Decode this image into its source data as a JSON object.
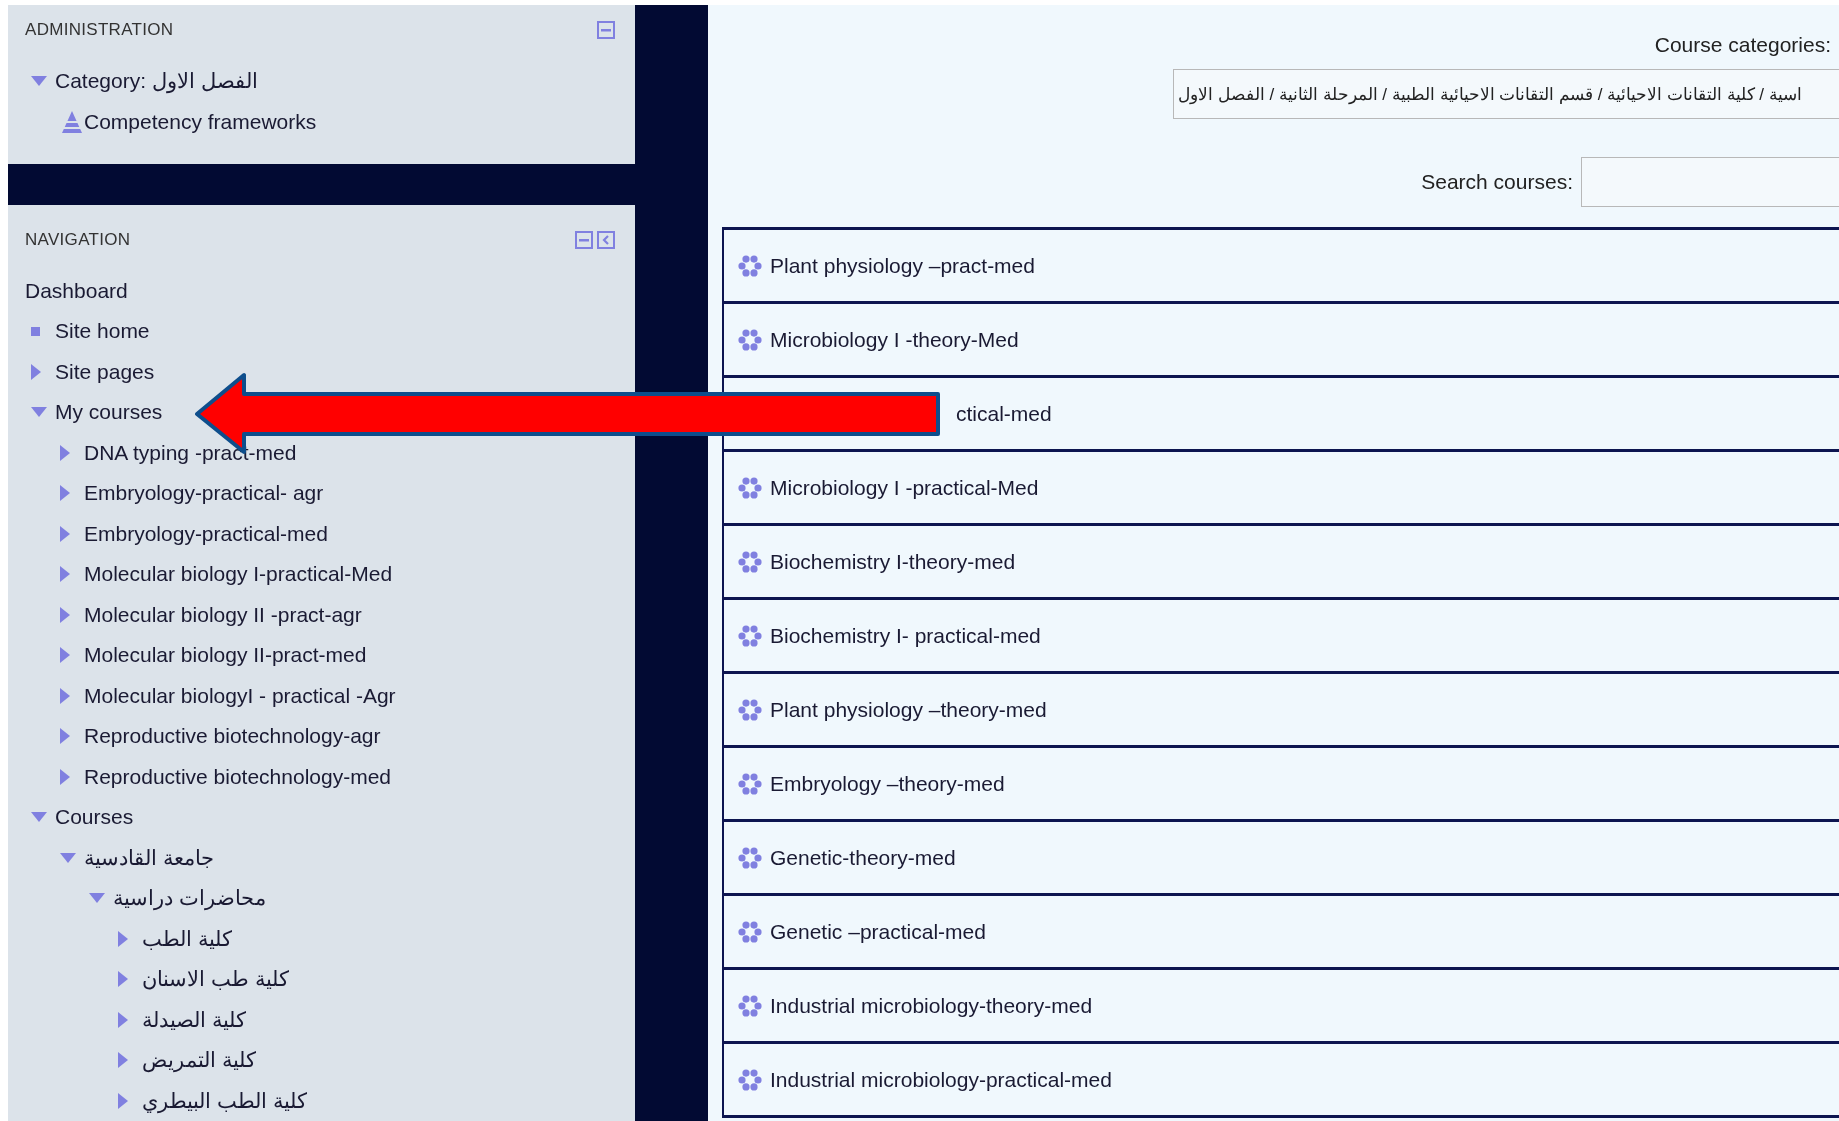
{
  "administration": {
    "title": "ADMINISTRATION",
    "items": [
      {
        "label": "Category: الفصل الاول",
        "kind": "node",
        "expanded": true,
        "children": [
          {
            "label": "Competency frameworks",
            "kind": "competency"
          }
        ]
      }
    ]
  },
  "navigation": {
    "title": "NAVIGATION",
    "items": [
      {
        "label": "Dashboard",
        "kind": "plain"
      },
      {
        "label": "Site home",
        "kind": "leaf"
      },
      {
        "label": "Site pages",
        "kind": "node",
        "expanded": false
      },
      {
        "label": "My courses",
        "kind": "node",
        "expanded": true,
        "children": [
          {
            "label": "DNA typing -pract-med",
            "kind": "node",
            "expanded": false
          },
          {
            "label": "Embryology-practical- agr",
            "kind": "node",
            "expanded": false
          },
          {
            "label": "Embryology-practical-med",
            "kind": "node",
            "expanded": false
          },
          {
            "label": "Molecular biology I-practical-Med",
            "kind": "node",
            "expanded": false
          },
          {
            "label": "Molecular biology II -pract-agr",
            "kind": "node",
            "expanded": false
          },
          {
            "label": "Molecular biology II-pract-med",
            "kind": "node",
            "expanded": false
          },
          {
            "label": "Molecular biologyI - practical -Agr",
            "kind": "node",
            "expanded": false
          },
          {
            "label": "Reproductive biotechnology-agr",
            "kind": "node",
            "expanded": false
          },
          {
            "label": "Reproductive biotechnology-med",
            "kind": "node",
            "expanded": false
          }
        ]
      },
      {
        "label": "Courses",
        "kind": "node",
        "expanded": true,
        "children": [
          {
            "label": "جامعة القادسية",
            "kind": "node",
            "expanded": true,
            "children": [
              {
                "label": "محاضرات دراسية",
                "kind": "node",
                "expanded": true,
                "children": [
                  {
                    "label": "كلية الطب",
                    "kind": "node",
                    "expanded": false
                  },
                  {
                    "label": "كلية طب الاسنان",
                    "kind": "node",
                    "expanded": false
                  },
                  {
                    "label": "كلية الصيدلة",
                    "kind": "node",
                    "expanded": false
                  },
                  {
                    "label": "كلية التمريض",
                    "kind": "node",
                    "expanded": false
                  },
                  {
                    "label": "كلية الطب البيطري",
                    "kind": "node",
                    "expanded": false
                  }
                ]
              }
            ]
          }
        ]
      }
    ]
  },
  "filters": {
    "categories_label": "Course categories:",
    "category_value": "اسية / كلية التقانات الاحيائية / قسم التقانات الاحيائية الطبية / المرحلة الثانية / الفصل الاول",
    "search_label": "Search courses:"
  },
  "courses": [
    {
      "name": "Plant physiology –pract-med",
      "covered": false
    },
    {
      "name": "Microbiology I -theory-Med",
      "covered": false
    },
    {
      "name": "ctical-med",
      "covered": true
    },
    {
      "name": "Microbiology I -practical-Med",
      "covered": false
    },
    {
      "name": "Biochemistry I-theory-med",
      "covered": false
    },
    {
      "name": "Biochemistry I- practical-med",
      "covered": false
    },
    {
      "name": "Plant physiology –theory-med",
      "covered": false
    },
    {
      "name": "Embryology –theory-med",
      "covered": false
    },
    {
      "name": "Genetic-theory-med",
      "covered": false
    },
    {
      "name": "Genetic –practical-med",
      "covered": false
    },
    {
      "name": "Industrial microbiology-theory-med",
      "covered": false
    },
    {
      "name": "Industrial microbiology-practical-med",
      "covered": false
    }
  ]
}
